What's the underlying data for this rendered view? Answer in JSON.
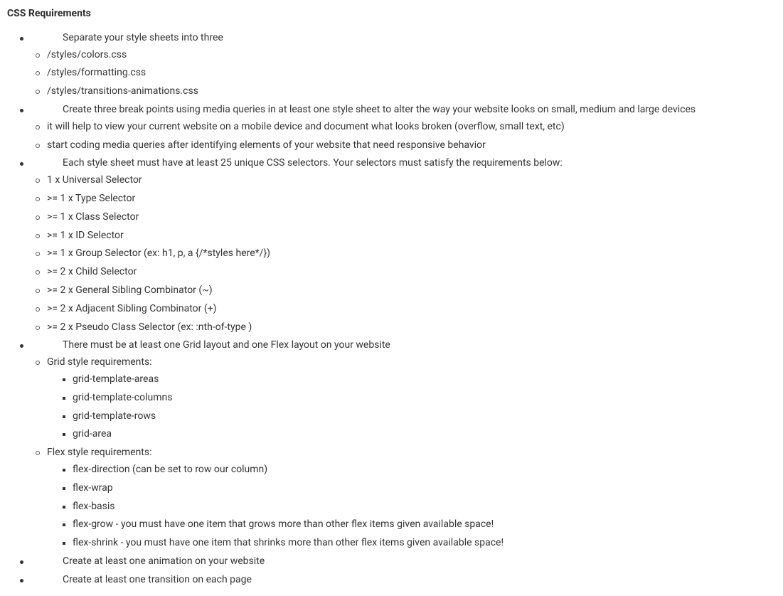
{
  "heading": "CSS Requirements",
  "items": {
    "sep_intro": "Separate your style sheets into three",
    "sep_files": {
      "a": "/styles/colors.css",
      "b": "/styles/formatting.css",
      "c": "/styles/transitions-animations.css"
    },
    "breakpoints_intro": "Create three break points using media queries in at least one style sheet to alter the way your website looks on small, medium and large devices",
    "breakpoints_sub": {
      "a": "it will help to view your current website on a mobile device and document what looks broken (overflow, small text, etc)",
      "b": "start coding media queries after identifying elements of your website that need responsive behavior"
    },
    "selectors_intro": "Each style sheet must have at least 25 unique CSS selectors. Your selectors must satisfy the requirements below:",
    "selectors": {
      "a": "1 x Universal Selector",
      "b": ">= 1 x Type Selector",
      "c": ">= 1 x Class Selector",
      "d": ">= 1 x ID Selector",
      "e": ">= 1 x Group Selector (ex: h1, p, a {/*styles here*/})",
      "f": ">= 2 x Child Selector",
      "g": ">= 2 x General Sibling Combinator (~)",
      "h": ">= 2 x Adjacent Sibling Combinator (+)",
      "i": ">= 2 x Pseudo Class Selector (ex: :nth-of-type )"
    },
    "layout_intro": "There must be at least one Grid layout and one Flex layout on your website",
    "grid_label": "Grid style requirements:",
    "grid": {
      "a": "grid-template-areas",
      "b": "grid-template-columns",
      "c": "grid-template-rows",
      "d": "grid-area"
    },
    "flex_label": "Flex style requirements:",
    "flex": {
      "a": "flex-direction (can be set to row our column)",
      "b": "flex-wrap",
      "c": "flex-basis",
      "d": "flex-grow - you must have one item that grows more than other flex items given available space!",
      "e": "flex-shrink - you must have one item that shrinks more than other flex items given available space!"
    },
    "animation": "Create at least one animation on your website",
    "transition": "Create at least one transition on each page"
  }
}
